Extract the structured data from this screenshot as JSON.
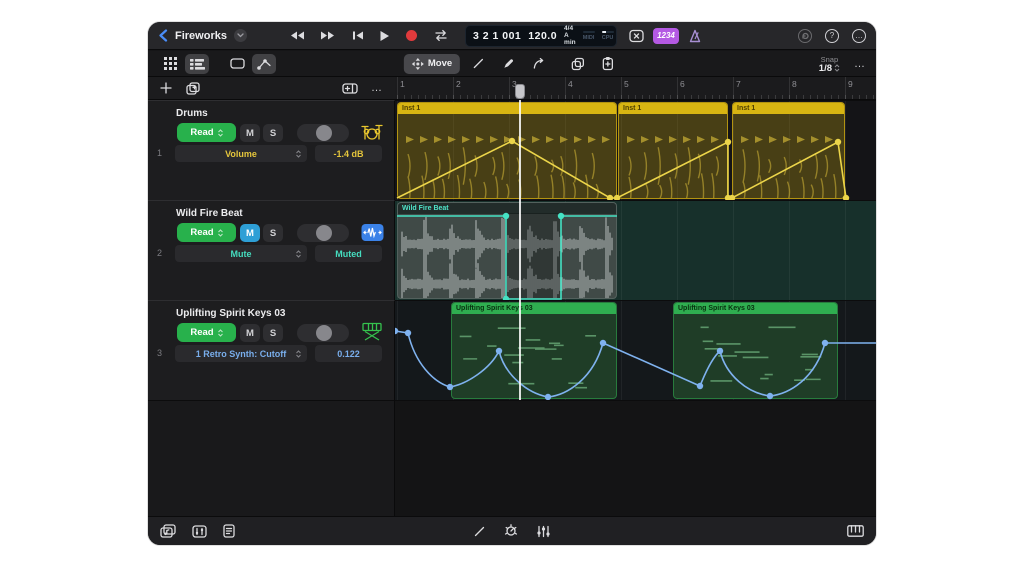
{
  "window": {
    "title": "Fireworks"
  },
  "lcd": {
    "position": "3 2 1 001",
    "tempo": "120.0",
    "time_signature": "4/4",
    "key": "A min",
    "midi_label": "MIDI",
    "cpu_label": "CPU"
  },
  "topbar": {
    "count_in_label": "1234",
    "help_label": "?",
    "more_label": "…"
  },
  "toolbar": {
    "move_label": "Move",
    "snap_label": "Snap",
    "snap_value": "1/8",
    "more_label": "…"
  },
  "track_panel": {
    "more_label": "…"
  },
  "tracks": [
    {
      "number": "1",
      "name": "Drums",
      "automation_mode": "Read",
      "mute_label": "M",
      "solo_label": "S",
      "param": "Volume",
      "value": "-1.4 dB",
      "accent_color": "#e5c63c"
    },
    {
      "number": "2",
      "name": "Wild Fire Beat",
      "automation_mode": "Read",
      "mute_label": "M",
      "solo_label": "S",
      "param": "Mute",
      "value": "Muted",
      "accent_color": "#45ddbf"
    },
    {
      "number": "3",
      "name": "Uplifting Spirit Keys 03",
      "automation_mode": "Read",
      "mute_label": "M",
      "solo_label": "S",
      "param": "1 Retro Synth: Cutoff",
      "value": "0.122",
      "accent_color": "#79aeec"
    }
  ],
  "ruler": {
    "bars": [
      "1",
      "2",
      "3",
      "4",
      "5",
      "6",
      "7",
      "8",
      "9"
    ]
  },
  "regions": {
    "track1": [
      {
        "label": "Inst 1"
      },
      {
        "label": "Inst 1"
      },
      {
        "label": "Inst 1"
      }
    ],
    "track2": [
      {
        "label": "Wild Fire Beat"
      }
    ],
    "track3": [
      {
        "label": "Uplifting Spirit Keys 03"
      },
      {
        "label": "Uplifting Spirit Keys 03"
      }
    ]
  },
  "colors": {
    "region_yellow": "#d8b512",
    "region_green": "#2fae50",
    "automation_yellow": "#ecd54a",
    "automation_teal": "#45e2c4",
    "automation_blue": "#7fb2ef",
    "read_green": "#28b14c",
    "mute_active_blue": "#2e9fd6",
    "record_red": "#e03a3c",
    "count_in_purple": "#b459e3",
    "back_blue": "#4a8df8"
  }
}
